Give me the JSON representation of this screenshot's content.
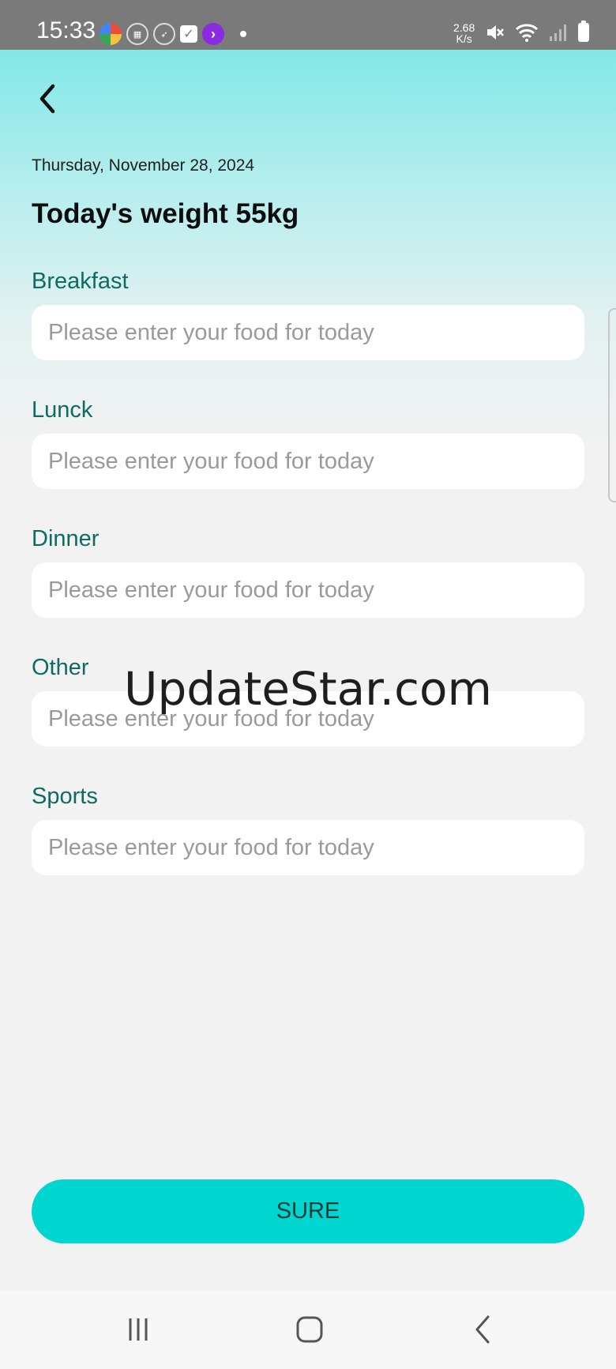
{
  "status_bar": {
    "time": "15:33",
    "network_speed_value": "2.68",
    "network_speed_unit": "K/s",
    "icons": [
      "app-icon-multicolor",
      "app-icon-grid",
      "app-icon-compass",
      "check-icon",
      "purple-play-icon",
      "notification-dot",
      "mute-icon",
      "wifi-icon",
      "signal-icon",
      "battery-icon"
    ]
  },
  "header": {
    "back_icon": "chevron-left-icon",
    "date": "Thursday, November 28, 2024",
    "weight_title": "Today's weight 55kg"
  },
  "meals": [
    {
      "label": "Breakfast",
      "placeholder": "Please enter your food for today",
      "value": ""
    },
    {
      "label": "Lunck",
      "placeholder": "Please enter your food for today",
      "value": ""
    },
    {
      "label": "Dinner",
      "placeholder": "Please enter your food for today",
      "value": ""
    },
    {
      "label": "Other",
      "placeholder": "Please enter your food for today",
      "value": ""
    },
    {
      "label": "Sports",
      "placeholder": "Please enter your food for today",
      "value": ""
    }
  ],
  "watermark": "UpdateStar.com",
  "sure_button": {
    "label": "SURE"
  },
  "nav_bar": {
    "icons": [
      "recent-apps-icon",
      "home-icon",
      "back-icon"
    ]
  },
  "colors": {
    "accent": "#00d6cf",
    "label": "#0e6b62",
    "gradient_top": "#82e8e7",
    "background": "#f2f2f2"
  }
}
